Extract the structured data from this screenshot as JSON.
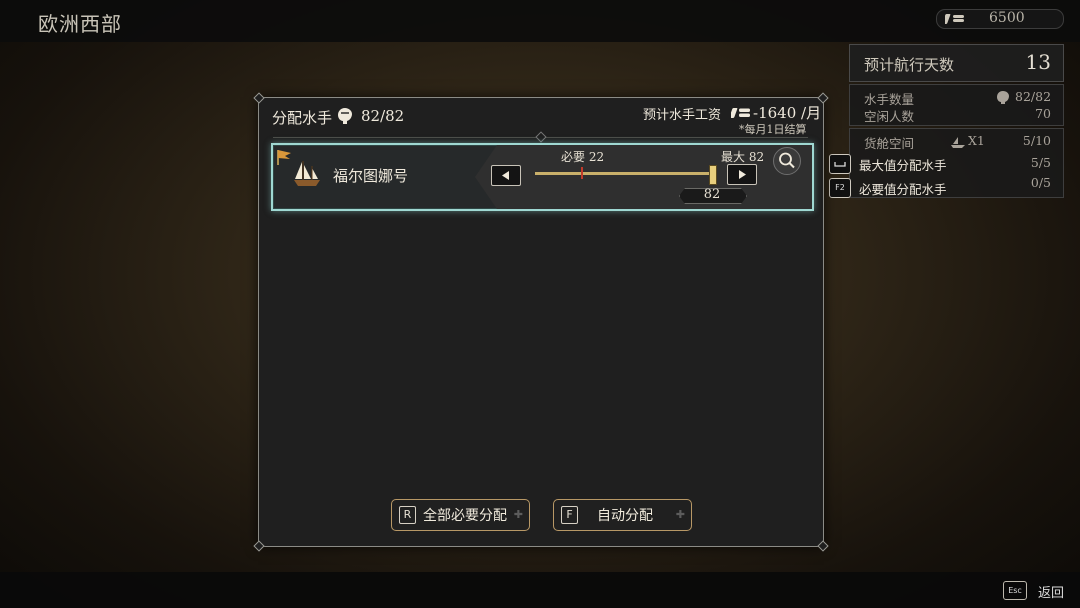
{
  "header": {
    "region": "欧洲西部",
    "gold": "6500"
  },
  "right_panel": {
    "voyage_days_label": "预计航行天数",
    "voyage_days_value": "13",
    "crew_count_label": "水手数量",
    "crew_count_value": "82/82",
    "idle_label": "空闲人数",
    "idle_value": "70",
    "cargo_label": "货舱空间",
    "cargo_multiplier": "X1",
    "cargo_value": "5/10",
    "row4_value": "5/5",
    "row5_value": "0/5"
  },
  "dialog": {
    "title": "分配水手",
    "crew_count": "82/82",
    "wage_label": "预计水手工资",
    "wage_value": "-1640 /月",
    "wage_note": "*每月1日结算",
    "ship": {
      "name": "福尔图娜号",
      "required_label": "必要 22",
      "max_label": "最大 82",
      "assigned": "82"
    },
    "buttons": {
      "all_required": {
        "key": "R",
        "label": "全部必要分配"
      },
      "auto": {
        "key": "F",
        "label": "自动分配"
      }
    }
  },
  "hints": [
    {
      "key": "",
      "label": "最大值分配水手"
    },
    {
      "key": "F2",
      "label": "必要值分配水手"
    }
  ],
  "footer": {
    "back_key": "Esc",
    "back_label": "返回"
  },
  "slider": {
    "required": 22,
    "max": 82,
    "value": 82
  },
  "colors": {
    "accent_teal": "#9fd8d2",
    "button_border": "#b89866",
    "required_marker": "#c23a2a",
    "slider_fill": "#c9b06a"
  }
}
